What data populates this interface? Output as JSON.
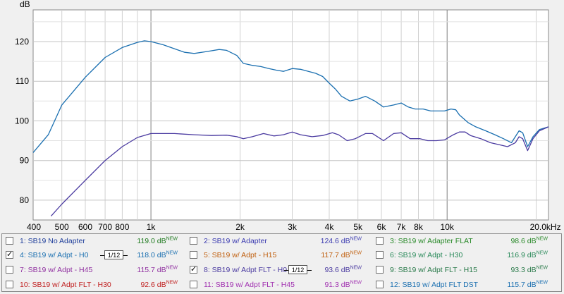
{
  "chart_data": {
    "type": "line",
    "ylabel": "dB",
    "x_scale": "log",
    "xlim": [
      400,
      22000
    ],
    "ylim": [
      75,
      128
    ],
    "grid": true,
    "x_ticks": [
      {
        "value": 400,
        "label": "400"
      },
      {
        "value": 500,
        "label": "500"
      },
      {
        "value": 600,
        "label": "600"
      },
      {
        "value": 700,
        "label": "700"
      },
      {
        "value": 800,
        "label": "800"
      },
      {
        "value": 1000,
        "label": "1k"
      },
      {
        "value": 2000,
        "label": "2k"
      },
      {
        "value": 3000,
        "label": "3k"
      },
      {
        "value": 4000,
        "label": "4k"
      },
      {
        "value": 5000,
        "label": "5k"
      },
      {
        "value": 6000,
        "label": "6k"
      },
      {
        "value": 7000,
        "label": "7k"
      },
      {
        "value": 8000,
        "label": "8k"
      },
      {
        "value": 10000,
        "label": "10k"
      },
      {
        "value": 20000,
        "label": "20.0kHz"
      }
    ],
    "y_ticks": [
      80,
      90,
      100,
      110,
      120
    ],
    "series": [
      {
        "name": "SB19 w/ Adpt - H0",
        "color": "#1a6fb0",
        "points": [
          [
            400,
            92
          ],
          [
            450,
            96.5
          ],
          [
            500,
            104
          ],
          [
            600,
            111
          ],
          [
            700,
            116
          ],
          [
            800,
            118.5
          ],
          [
            900,
            119.8
          ],
          [
            950,
            120.2
          ],
          [
            1000,
            120
          ],
          [
            1100,
            119.2
          ],
          [
            1200,
            118.2
          ],
          [
            1300,
            117.3
          ],
          [
            1400,
            117
          ],
          [
            1550,
            117.5
          ],
          [
            1700,
            118
          ],
          [
            1800,
            117.8
          ],
          [
            1950,
            116.5
          ],
          [
            2050,
            114.5
          ],
          [
            2200,
            114
          ],
          [
            2350,
            113.7
          ],
          [
            2500,
            113.2
          ],
          [
            2650,
            112.8
          ],
          [
            2800,
            112.5
          ],
          [
            3000,
            113.2
          ],
          [
            3200,
            113
          ],
          [
            3400,
            112.5
          ],
          [
            3600,
            112
          ],
          [
            3800,
            111.2
          ],
          [
            4000,
            109.5
          ],
          [
            4200,
            108
          ],
          [
            4400,
            106.2
          ],
          [
            4700,
            105
          ],
          [
            5000,
            105.5
          ],
          [
            5300,
            106.2
          ],
          [
            5700,
            105
          ],
          [
            6100,
            103.5
          ],
          [
            6600,
            104
          ],
          [
            7000,
            104.5
          ],
          [
            7400,
            103.5
          ],
          [
            7800,
            103
          ],
          [
            8300,
            103
          ],
          [
            8800,
            102.5
          ],
          [
            9300,
            102.5
          ],
          [
            9800,
            102.5
          ],
          [
            10300,
            103
          ],
          [
            10700,
            102.8
          ],
          [
            11000,
            101.5
          ],
          [
            11800,
            99.5
          ],
          [
            12500,
            98.5
          ],
          [
            13500,
            97.5
          ],
          [
            14500,
            96.5
          ],
          [
            15500,
            95.5
          ],
          [
            16500,
            94.5
          ],
          [
            17500,
            97.5
          ],
          [
            18000,
            97
          ],
          [
            18700,
            93.5
          ],
          [
            19500,
            96
          ],
          [
            20500,
            97.8
          ],
          [
            22000,
            98.5
          ]
        ]
      },
      {
        "name": "SB19 w/ Adpt FLT - H0",
        "color": "#4a3aa0",
        "points": [
          [
            460,
            76
          ],
          [
            500,
            79
          ],
          [
            600,
            85
          ],
          [
            700,
            90
          ],
          [
            800,
            93.5
          ],
          [
            900,
            95.8
          ],
          [
            1000,
            96.8
          ],
          [
            1200,
            96.8
          ],
          [
            1400,
            96.5
          ],
          [
            1600,
            96.3
          ],
          [
            1800,
            96.4
          ],
          [
            1950,
            96
          ],
          [
            2050,
            95.5
          ],
          [
            2200,
            96
          ],
          [
            2400,
            96.8
          ],
          [
            2600,
            96.2
          ],
          [
            2800,
            96.5
          ],
          [
            3000,
            97.2
          ],
          [
            3200,
            96.5
          ],
          [
            3500,
            96
          ],
          [
            3800,
            96.3
          ],
          [
            4100,
            97
          ],
          [
            4300,
            96.5
          ],
          [
            4600,
            95
          ],
          [
            4900,
            95.5
          ],
          [
            5300,
            96.8
          ],
          [
            5600,
            96.8
          ],
          [
            6100,
            95
          ],
          [
            6600,
            96.8
          ],
          [
            7000,
            97
          ],
          [
            7500,
            95.5
          ],
          [
            8100,
            95.5
          ],
          [
            8600,
            95
          ],
          [
            9200,
            95
          ],
          [
            9800,
            95.2
          ],
          [
            10500,
            96.5
          ],
          [
            11000,
            97.2
          ],
          [
            11500,
            97.2
          ],
          [
            12000,
            96.3
          ],
          [
            13000,
            95.5
          ],
          [
            14000,
            94.5
          ],
          [
            15000,
            94
          ],
          [
            16000,
            93.5
          ],
          [
            17000,
            94.5
          ],
          [
            17500,
            96
          ],
          [
            18000,
            95.5
          ],
          [
            18700,
            92.5
          ],
          [
            19500,
            95.5
          ],
          [
            20500,
            97.5
          ],
          [
            22000,
            98.5
          ]
        ]
      }
    ]
  },
  "legend": {
    "items": [
      {
        "index": "1:",
        "label": "SB19 No Adapter",
        "value": "119.0 dB",
        "sup": "NEW",
        "checked": false,
        "color": "#1f3e9a",
        "valcolor": "#1f7a1f",
        "smoothing": ""
      },
      {
        "index": "2:",
        "label": "SB19 w/ Adapter",
        "value": "124.6 dB",
        "sup": "NEW",
        "checked": false,
        "color": "#3a3ab0",
        "valcolor": "#3a3ab0",
        "smoothing": ""
      },
      {
        "index": "3:",
        "label": "SB19 w/ Adapter FLAT",
        "value": "98.6 dB",
        "sup": "NEW",
        "checked": false,
        "color": "#2a8a2a",
        "valcolor": "#2a8a2a",
        "smoothing": ""
      },
      {
        "index": "4:",
        "label": "SB19 w/ Adpt - H0",
        "value": "118.0 dB",
        "sup": "NEW",
        "checked": true,
        "color": "#1a6fb0",
        "valcolor": "#1a6fb0",
        "smoothing": "1/12"
      },
      {
        "index": "5:",
        "label": "SB19 w/ Adpt - H15",
        "value": "117.7 dB",
        "sup": "NEW",
        "checked": false,
        "color": "#c06010",
        "valcolor": "#c06010",
        "smoothing": ""
      },
      {
        "index": "6:",
        "label": "SB19 w/ Adpt - H30",
        "value": "116.9 dB",
        "sup": "NEW",
        "checked": false,
        "color": "#2a8a5a",
        "valcolor": "#2a8a5a",
        "smoothing": ""
      },
      {
        "index": "7:",
        "label": "SB19 w/ Adpt - H45",
        "value": "115.7 dB",
        "sup": "NEW",
        "checked": false,
        "color": "#9030a0",
        "valcolor": "#9030a0",
        "smoothing": ""
      },
      {
        "index": "8:",
        "label": "SB19 w/ Adpt FLT - H0",
        "value": "93.6 dB",
        "sup": "NEW",
        "checked": true,
        "color": "#4a3aa0",
        "valcolor": "#4a3aa0",
        "smoothing": "1/12"
      },
      {
        "index": "9:",
        "label": "SB19 w/ Adpt FLT - H15",
        "value": "93.3 dB",
        "sup": "NEW",
        "checked": false,
        "color": "#2a7a4a",
        "valcolor": "#2a7a4a",
        "smoothing": ""
      },
      {
        "index": "10:",
        "label": "SB19 w/ Adpt FLT - H30",
        "value": "92.6 dB",
        "sup": "NEW",
        "checked": false,
        "color": "#c02020",
        "valcolor": "#c02020",
        "smoothing": ""
      },
      {
        "index": "11:",
        "label": "SB19 w/ Adpt FLT - H45",
        "value": "91.3 dB",
        "sup": "NEW",
        "checked": false,
        "color": "#a030b0",
        "valcolor": "#a030b0",
        "smoothing": ""
      },
      {
        "index": "12:",
        "label": "SB19 w/ Adpt FLT DST",
        "value": "115.7 dB",
        "sup": "NEW",
        "checked": false,
        "color": "#1a6fb0",
        "valcolor": "#1a6fb0",
        "smoothing": ""
      }
    ]
  }
}
